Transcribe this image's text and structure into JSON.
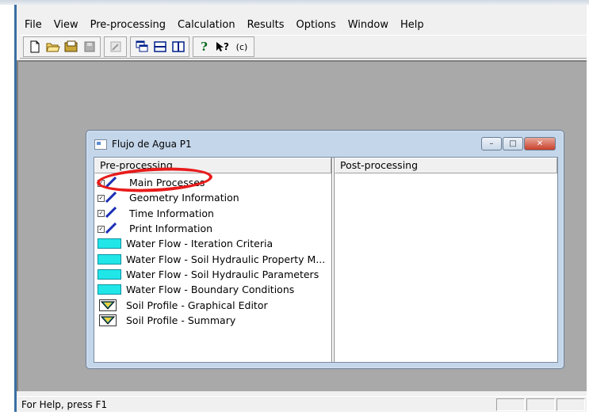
{
  "menu": {
    "items": [
      "File",
      "View",
      "Pre-processing",
      "Calculation",
      "Results",
      "Options",
      "Window",
      "Help"
    ]
  },
  "toolbar": {
    "help_question_label": "?",
    "context_help_label": "?",
    "copyright_label": "(c)"
  },
  "child_window": {
    "title": "Flujo de Agua P1",
    "left_header": "Pre-processing",
    "right_header": "Post-processing",
    "items": [
      {
        "label": "Main Processes",
        "icon": "checkbox-pen-icon"
      },
      {
        "label": "Geometry Information",
        "icon": "checkbox-pen-icon"
      },
      {
        "label": "Time Information",
        "icon": "checkbox-pen-icon"
      },
      {
        "label": "Print Information",
        "icon": "checkbox-pen-icon"
      },
      {
        "label": "Water Flow - Iteration Criteria",
        "icon": "water-icon"
      },
      {
        "label": "Water Flow - Soil Hydraulic Property M...",
        "icon": "water-icon"
      },
      {
        "label": "Water Flow - Soil Hydraulic Parameters",
        "icon": "water-icon"
      },
      {
        "label": "Water Flow - Boundary Conditions",
        "icon": "water-icon"
      },
      {
        "label": "Soil Profile - Graphical Editor",
        "icon": "soil-profile-icon"
      },
      {
        "label": "Soil Profile - Summary",
        "icon": "soil-profile-icon"
      }
    ]
  },
  "status": {
    "text": "For Help, press F1"
  },
  "colors": {
    "mdi_background": "#a9a9a9",
    "water_icon": "#20e6e8",
    "highlight": "#e81b1b"
  }
}
